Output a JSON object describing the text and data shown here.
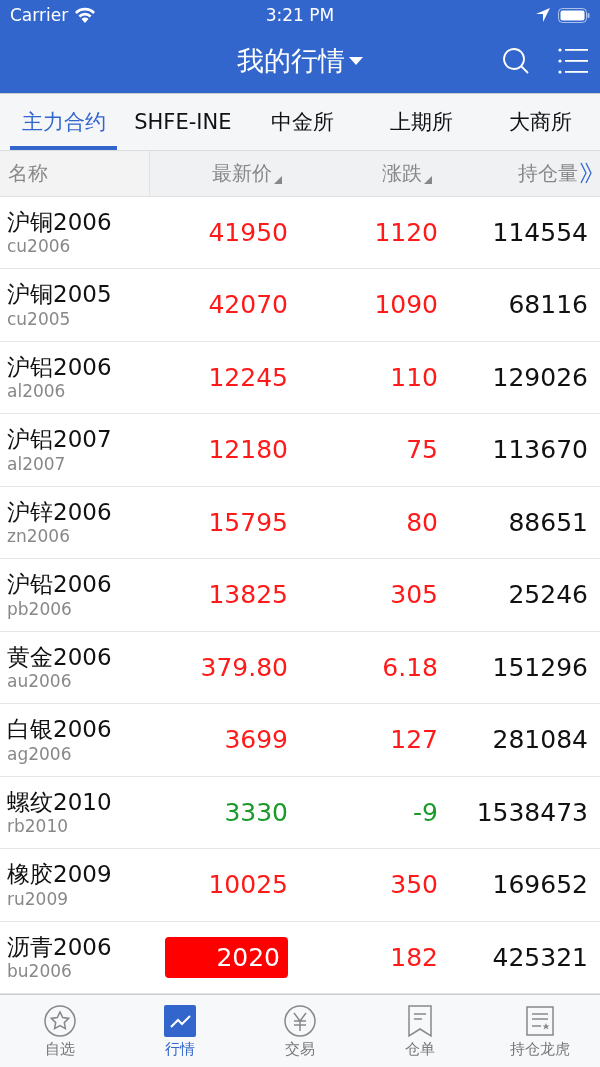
{
  "status_bar": {
    "carrier": "Carrier",
    "time": "3:21 PM"
  },
  "nav": {
    "title": "我的行情"
  },
  "tabs": [
    {
      "label": "主力合约",
      "selected": true
    },
    {
      "label": "SHFE-INE",
      "selected": false
    },
    {
      "label": "中金所",
      "selected": false
    },
    {
      "label": "上期所",
      "selected": false
    },
    {
      "label": "大商所",
      "selected": false
    }
  ],
  "columns": [
    {
      "label": "名称",
      "kind": "plain"
    },
    {
      "label": "最新价",
      "kind": "sort"
    },
    {
      "label": "涨跌",
      "kind": "sort"
    },
    {
      "label": "持仓量",
      "kind": "more"
    }
  ],
  "rows": [
    {
      "name": "沪铜2006",
      "code": "cu2006",
      "price": "41950",
      "change": "1120",
      "open_interest": "114554",
      "color": "#ff1a1a",
      "highlighted": false
    },
    {
      "name": "沪铜2005",
      "code": "cu2005",
      "price": "42070",
      "change": "1090",
      "open_interest": "68116",
      "color": "#ff1a1a",
      "highlighted": false
    },
    {
      "name": "沪铝2006",
      "code": "al2006",
      "price": "12245",
      "change": "110",
      "open_interest": "129026",
      "color": "#ff1a1a",
      "highlighted": false
    },
    {
      "name": "沪铝2007",
      "code": "al2007",
      "price": "12180",
      "change": "75",
      "open_interest": "113670",
      "color": "#ff1a1a",
      "highlighted": false
    },
    {
      "name": "沪锌2006",
      "code": "zn2006",
      "price": "15795",
      "change": "80",
      "open_interest": "88651",
      "color": "#ff1a1a",
      "highlighted": false
    },
    {
      "name": "沪铅2006",
      "code": "pb2006",
      "price": "13825",
      "change": "305",
      "open_interest": "25246",
      "color": "#ff1a1a",
      "highlighted": false
    },
    {
      "name": "黄金2006",
      "code": "au2006",
      "price": "379.80",
      "change": "6.18",
      "open_interest": "151296",
      "color": "#ff1a1a",
      "highlighted": false
    },
    {
      "name": "白银2006",
      "code": "ag2006",
      "price": "3699",
      "change": "127",
      "open_interest": "281084",
      "color": "#ff1a1a",
      "highlighted": false
    },
    {
      "name": "螺纹2010",
      "code": "rb2010",
      "price": "3330",
      "change": "-9",
      "open_interest": "1538473",
      "color": "#1a9a2a",
      "highlighted": false
    },
    {
      "name": "橡胶2009",
      "code": "ru2009",
      "price": "10025",
      "change": "350",
      "open_interest": "169652",
      "color": "#ff1a1a",
      "highlighted": false
    },
    {
      "name": "沥青2006",
      "code": "bu2006",
      "price": "2020",
      "change": "182",
      "open_interest": "425321",
      "color": "#ff1a1a",
      "highlighted": true
    }
  ],
  "bottom_tabs": [
    {
      "label": "自选",
      "selected": false
    },
    {
      "label": "行情",
      "selected": true
    },
    {
      "label": "交易",
      "selected": false
    },
    {
      "label": "仓单",
      "selected": false
    },
    {
      "label": "持仓龙虎",
      "selected": false
    }
  ]
}
